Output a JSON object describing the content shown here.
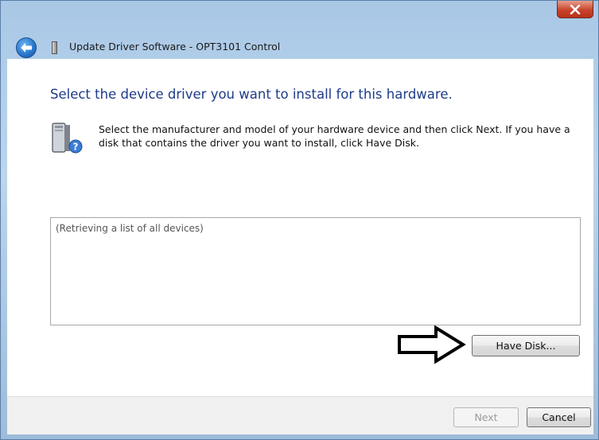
{
  "window": {
    "title": "Update Driver Software - OPT3101 Control",
    "close_icon": "close-icon",
    "back_icon": "back-arrow-icon"
  },
  "main": {
    "heading": "Select the device driver you want to install for this hardware.",
    "description": "Select the manufacturer and model of your hardware device and then click Next. If you have a disk that contains the driver you want to install, click Have Disk.",
    "hardware_icon": "hardware-question-icon",
    "list_placeholder": "(Retrieving a list of all devices)",
    "have_disk_label": "Have Disk...",
    "arrow_icon": "right-arrow-icon"
  },
  "footer": {
    "next_label": "Next",
    "cancel_label": "Cancel"
  },
  "colors": {
    "heading": "#1e3b8a",
    "titlebar": "#a9c8e6",
    "close": "#c9442b"
  }
}
